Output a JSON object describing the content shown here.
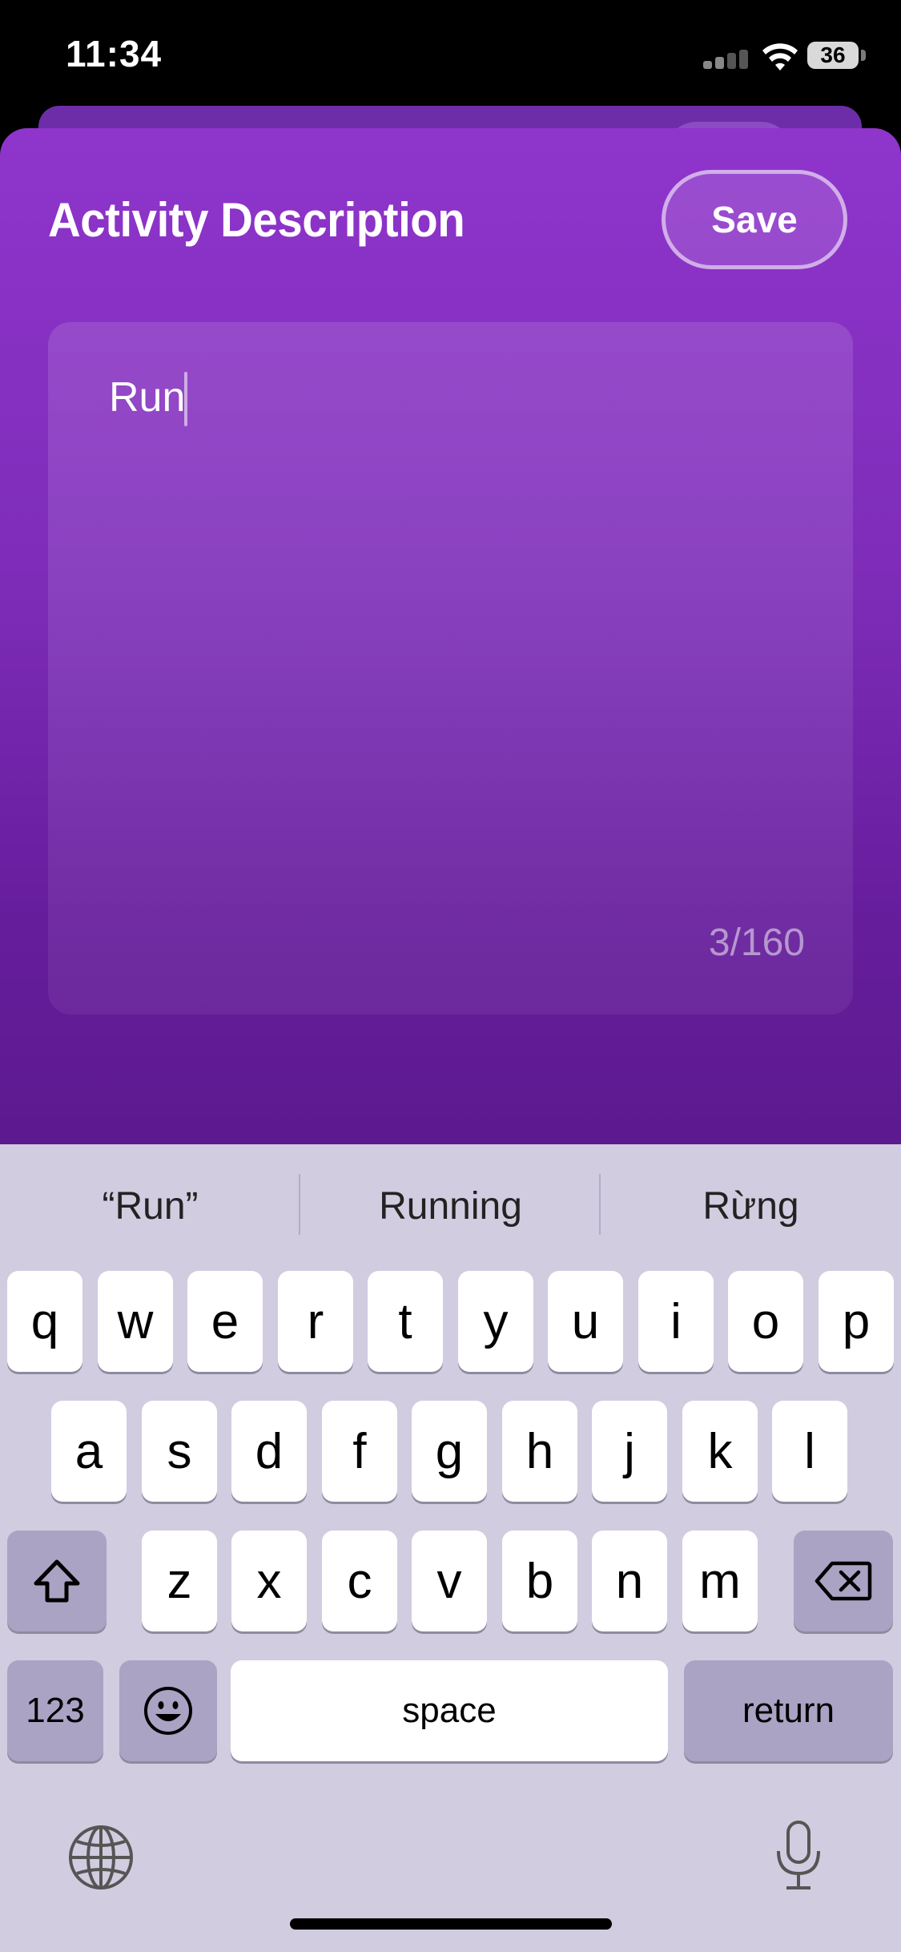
{
  "status_bar": {
    "time": "11:34",
    "battery": "36"
  },
  "sheet": {
    "title": "Activity Description",
    "save_label": "Save",
    "text_value": "Run",
    "char_count": "3/160"
  },
  "keyboard": {
    "suggestions": [
      "“Run”",
      "Running",
      "Rừng"
    ],
    "row1": [
      "q",
      "w",
      "e",
      "r",
      "t",
      "y",
      "u",
      "i",
      "o",
      "p"
    ],
    "row2": [
      "a",
      "s",
      "d",
      "f",
      "g",
      "h",
      "j",
      "k",
      "l"
    ],
    "row3": [
      "z",
      "x",
      "c",
      "v",
      "b",
      "n",
      "m"
    ],
    "numbers_label": "123",
    "space_label": "space",
    "return_label": "return"
  },
  "colors": {
    "sheet_top": "#8f35cc",
    "sheet_bottom": "#5c1a8f",
    "keyboard_bg": "#d1ccdf"
  }
}
